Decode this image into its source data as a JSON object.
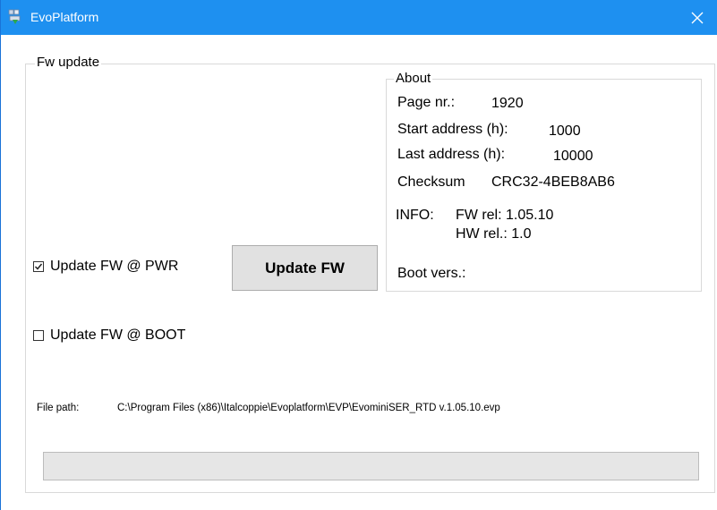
{
  "window": {
    "title": "EvoPlatform",
    "app_icon": "evoplatform-app-icon",
    "close_icon": "close-icon",
    "accent_color": "#1e90f0"
  },
  "fw_update": {
    "group_label": "Fw update",
    "update_pwr": {
      "label": "Update FW @ PWR",
      "checked": true
    },
    "update_boot": {
      "label": "Update FW @ BOOT",
      "checked": false
    },
    "update_button_label": "Update FW",
    "file_path_label": "File path:",
    "file_path_value": "C:\\Program Files (x86)\\Italcoppie\\Evoplatform\\EVP\\EvominiSER_RTD v.1.05.10.evp",
    "progress_fraction": 0
  },
  "about": {
    "group_label": "About",
    "page_nr_label": "Page nr.:",
    "page_nr_value": "1920",
    "start_address_label": "Start address (h):",
    "start_address_value": "1000",
    "last_address_label": "Last address (h):",
    "last_address_value": "10000",
    "checksum_label": "Checksum",
    "checksum_value": "CRC32-4BEB8AB6",
    "info_label": "INFO:",
    "fw_rel": "FW rel: 1.05.10",
    "hw_rel": "HW rel.: 1.0",
    "boot_vers_label": "Boot vers.:"
  }
}
